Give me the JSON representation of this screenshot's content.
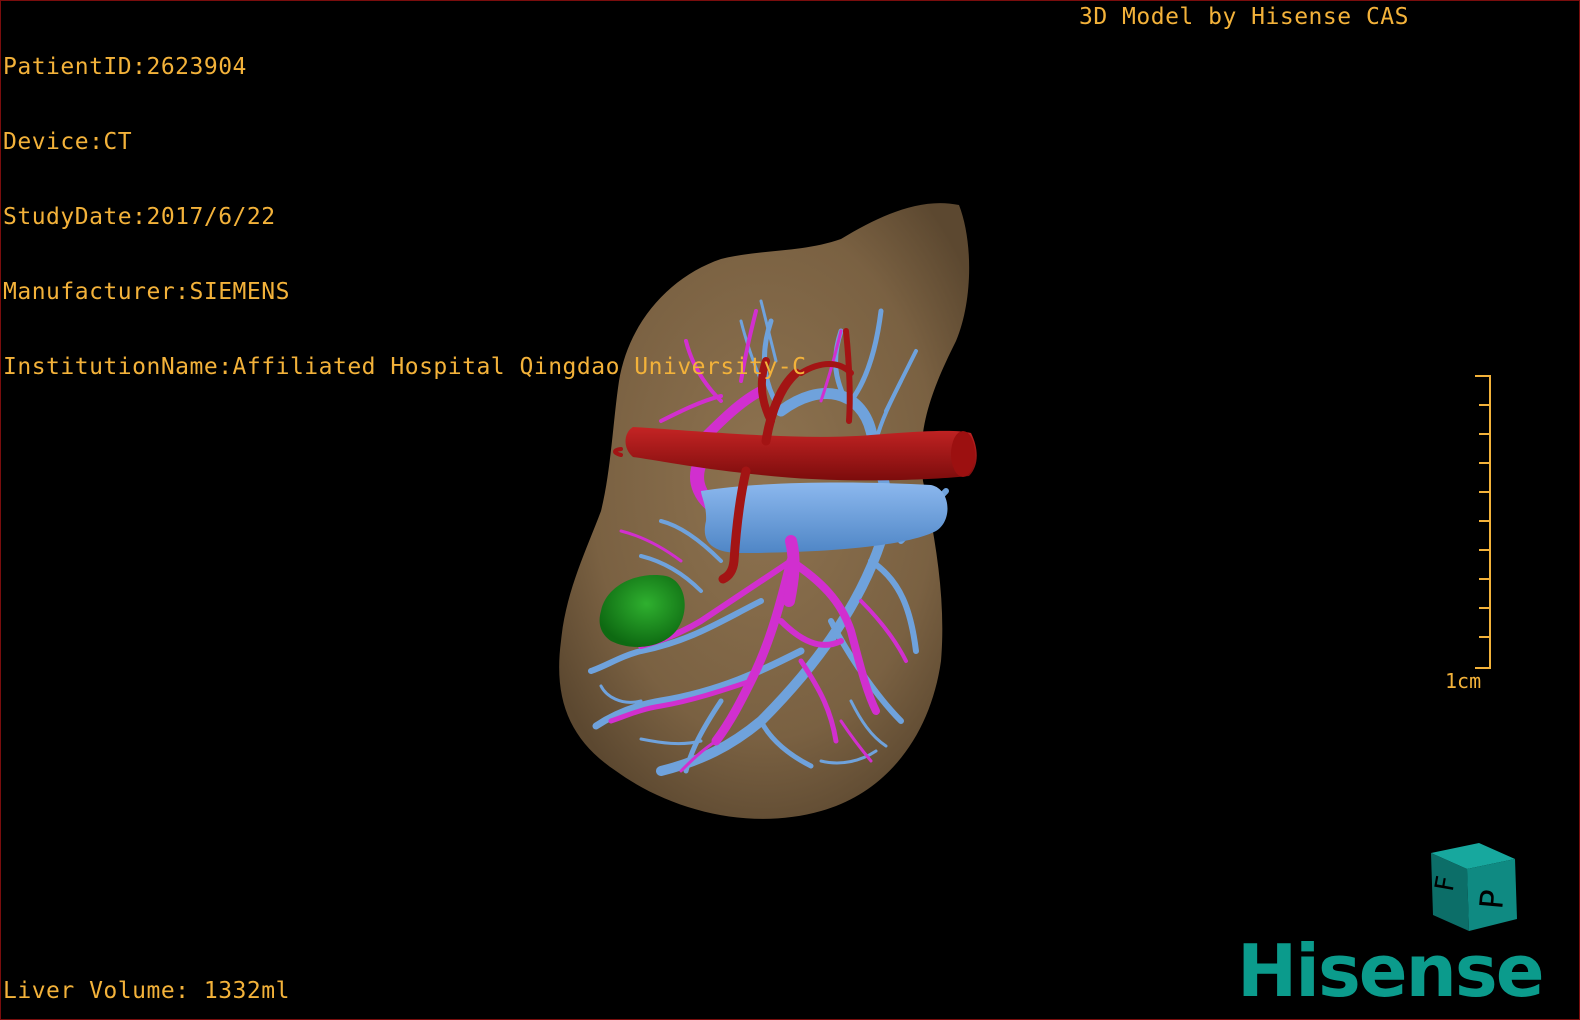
{
  "header": {
    "patient_id": "PatientID:2623904",
    "device": "Device:CT",
    "study_date": "StudyDate:2017/6/22",
    "manufacturer": "Manufacturer:SIEMENS",
    "institution": "InstitutionName:Affiliated Hospital Qingdao University-C"
  },
  "brand_text": "3D Model by Hisense CAS",
  "footer": {
    "liver_volume": "Liver Volume: 1332ml"
  },
  "scale_bar": {
    "label": "1cm"
  },
  "orientation_cube": {
    "face_front": "P",
    "face_side": "F"
  },
  "logo": {
    "text": "Hisense"
  },
  "colors": {
    "overlay_text": "#f3b23a",
    "liver": "#7d6443",
    "hepatic_vein": "#6fa2dc",
    "portal_vein": "#d12fcf",
    "artery": "#a31414",
    "lesion": "#1c8a1c",
    "logo": "#0b9b8c",
    "cube": "#0f7f78"
  }
}
